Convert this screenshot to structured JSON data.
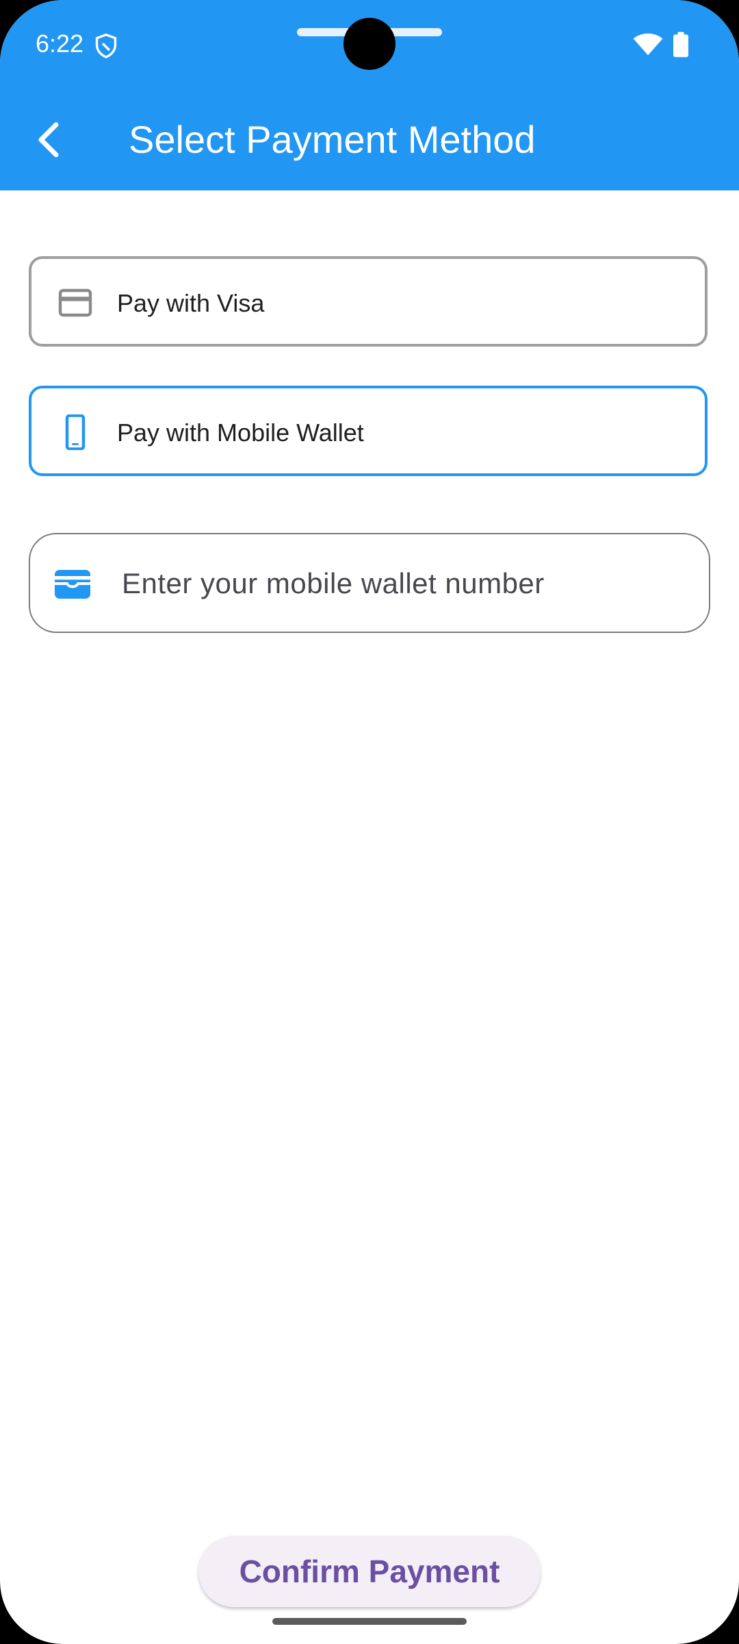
{
  "status_bar": {
    "time": "6:22",
    "icons": [
      "shield-icon",
      "wifi-icon",
      "battery-icon"
    ]
  },
  "app_bar": {
    "title": "Select Payment Method",
    "back_icon": "chevron-left-icon",
    "color": "#2196F3"
  },
  "payment_options": [
    {
      "label": "Pay with Visa",
      "icon": "credit-card-icon",
      "selected": false
    },
    {
      "label": "Pay with Mobile Wallet",
      "icon": "smartphone-icon",
      "selected": true
    }
  ],
  "wallet_field": {
    "placeholder": "Enter your mobile wallet number",
    "value": "",
    "icon": "wallet-icon"
  },
  "confirm_button": {
    "label": "Confirm Payment"
  },
  "colors": {
    "primary": "#2196F3",
    "unselected_border": "#9e9e9e",
    "button_text": "#6a4fa3",
    "button_bg": "#f4eff7"
  }
}
